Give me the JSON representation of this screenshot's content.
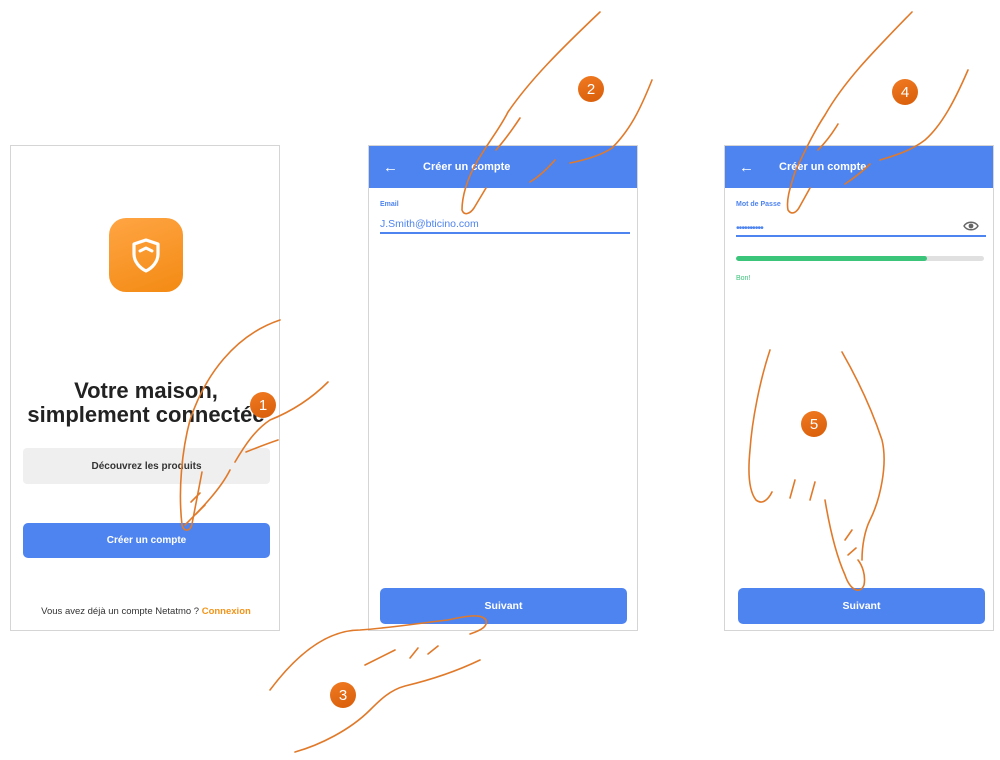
{
  "screen1": {
    "headline_line1": "Votre maison,",
    "headline_line2": "simplement connectée",
    "discover_label": "Découvrez les produits",
    "create_label": "Créer un compte",
    "footer_text": "Vous avez déjà un compte Netatmo ?",
    "footer_link": "Connexion"
  },
  "screen2": {
    "title": "Créer un compte",
    "email_label": "Email",
    "email_value": "J.Smith@bticino.com",
    "next_label": "Suivant"
  },
  "screen3": {
    "title": "Créer un compte",
    "password_label": "Mot de Passe",
    "password_value": "••••••••••",
    "strength_text": "Bon!",
    "strength_level": 0.77,
    "next_label": "Suivant"
  },
  "steps": [
    "1",
    "2",
    "3",
    "4",
    "5"
  ],
  "colors": {
    "accent": "#4e84f0",
    "brand": "#f39418",
    "strength": "#3bc57a",
    "badge": "#e06a13"
  }
}
